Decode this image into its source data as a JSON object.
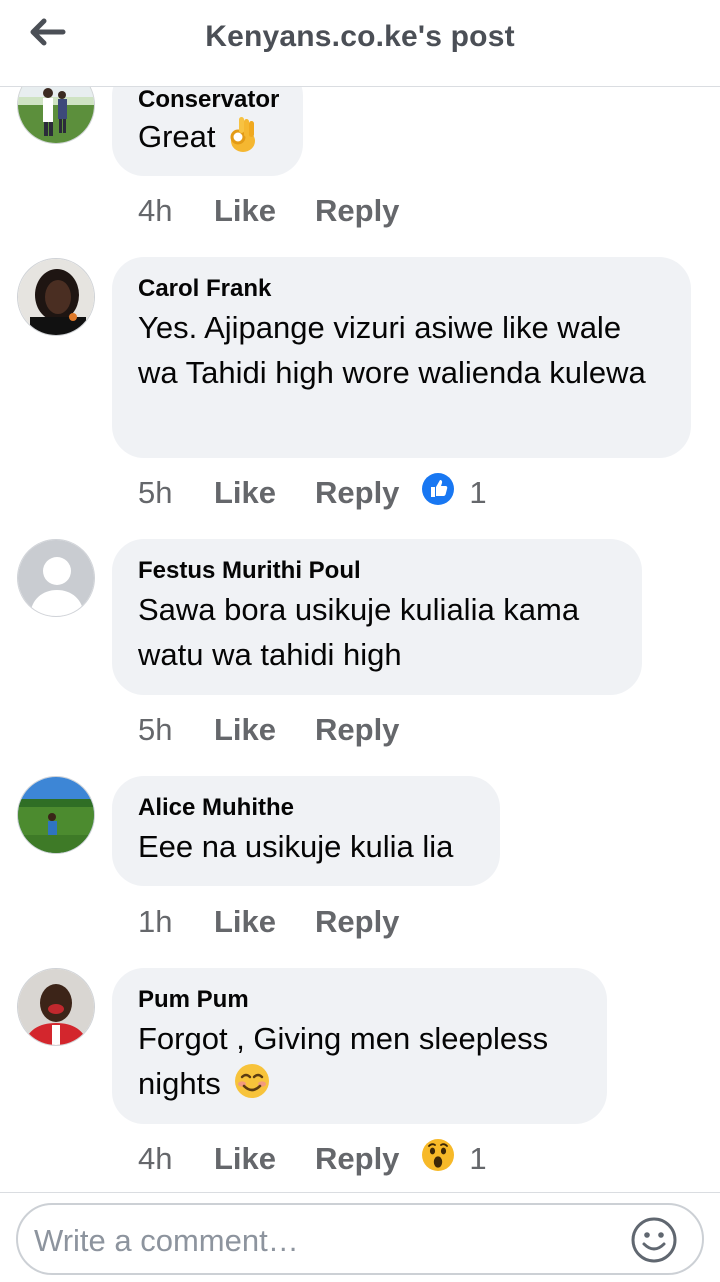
{
  "header": {
    "title": "Kenyans.co.ke's post",
    "back_icon": "arrow-left-icon"
  },
  "comments": [
    {
      "author": "Conservator",
      "text": "Great",
      "emoji": "ok-hand-emoji",
      "time": "4h",
      "like_label": "Like",
      "reply_label": "Reply"
    },
    {
      "author": "Carol Frank",
      "text": "Yes. Ajipange vizuri asiwe like wale wa Tahidi high wore walienda kulewa",
      "time": "5h",
      "like_label": "Like",
      "reply_label": "Reply",
      "reaction": {
        "icon": "like-reaction-icon",
        "count": "1",
        "color": "#1877f2"
      }
    },
    {
      "author": "Festus Murithi Poul",
      "text": "Sawa bora usikuje kulialia kama watu wa tahidi high",
      "time": "5h",
      "like_label": "Like",
      "reply_label": "Reply"
    },
    {
      "author": "Alice Muhithe",
      "text": "Eee na usikuje kulia lia",
      "time": "1h",
      "like_label": "Like",
      "reply_label": "Reply"
    },
    {
      "author": "Pum Pum",
      "text": "Forgot , Giving men sleepless nights",
      "emoji": "smiling-face-emoji",
      "time": "4h",
      "like_label": "Like",
      "reply_label": "Reply",
      "reaction": {
        "icon": "wow-reaction-icon",
        "count": "1",
        "color": "#f7b928"
      }
    }
  ],
  "composer": {
    "placeholder": "Write a comment…",
    "emoji_icon": "smiley-icon"
  },
  "colors": {
    "bubble": "#f0f2f5",
    "meta_text": "#65676b",
    "header_text": "#4b4f56",
    "like_blue": "#1877f2"
  }
}
